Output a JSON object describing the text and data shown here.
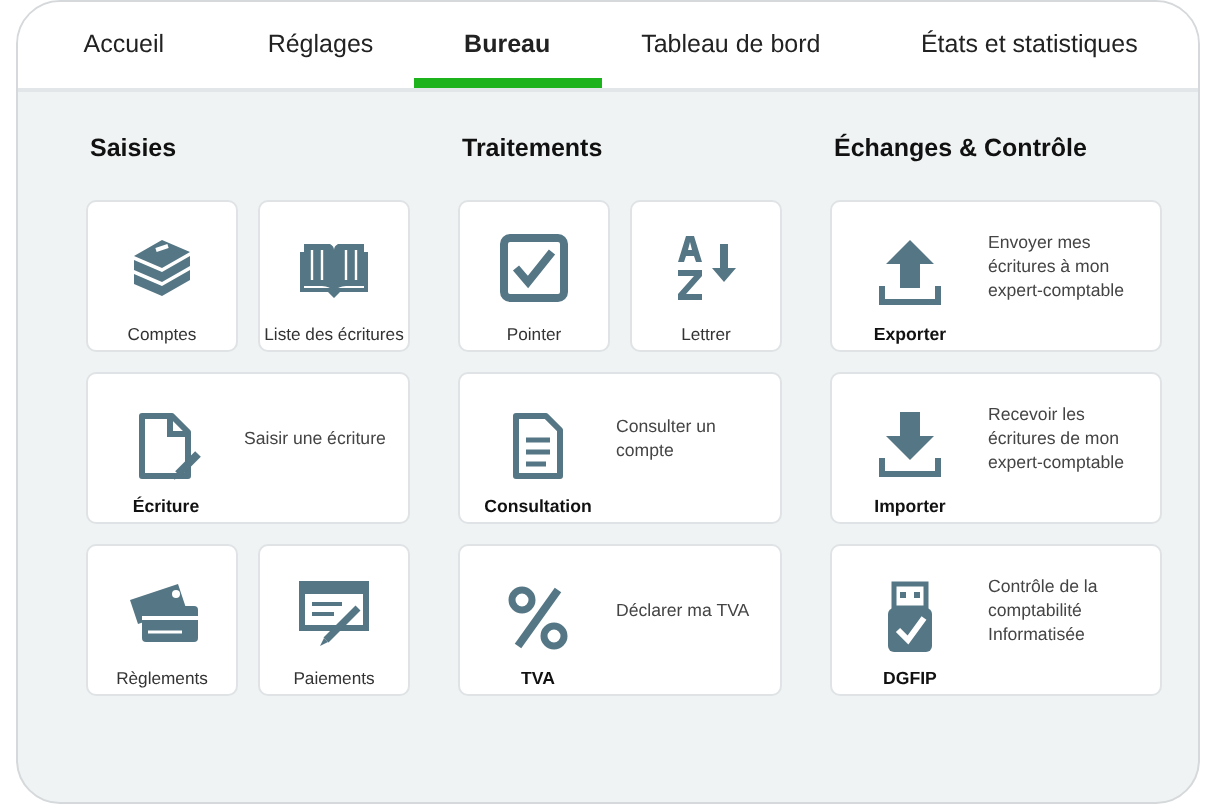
{
  "tabs": [
    {
      "label": "Accueil",
      "selected": false
    },
    {
      "label": "Réglages",
      "selected": false
    },
    {
      "label": "Bureau",
      "selected": true
    },
    {
      "label": "Tableau de bord",
      "selected": false
    },
    {
      "label": "États et statistiques",
      "selected": false
    }
  ],
  "sections": [
    {
      "title": "Saisies",
      "tiles": [
        {
          "kind": "small",
          "label": "Comptes"
        },
        {
          "kind": "small",
          "label": "Liste des écritures"
        },
        {
          "kind": "wide",
          "label": "Écriture",
          "description": "Saisir une écriture"
        },
        {
          "kind": "small",
          "label": "Règlements"
        },
        {
          "kind": "small",
          "label": "Paiements"
        }
      ]
    },
    {
      "title": "Traitements",
      "tiles": [
        {
          "kind": "small",
          "label": "Pointer"
        },
        {
          "kind": "small",
          "label": "Lettrer"
        },
        {
          "kind": "wide",
          "label": "Consultation",
          "description": "Consulter un compte"
        },
        {
          "kind": "wide",
          "label": "TVA",
          "description": "Déclarer ma TVA"
        }
      ]
    },
    {
      "title": "Échanges & Contrôle",
      "tiles": [
        {
          "kind": "wide",
          "label": "Exporter",
          "description": "Envoyer mes écritures à mon expert-comptable"
        },
        {
          "kind": "wide",
          "label": "Importer",
          "description": "Recevoir les écritures de mon expert-comptable"
        },
        {
          "kind": "wide",
          "label": "DGFIP",
          "description": "Contrôle de la comptabilité Informatisée"
        }
      ]
    }
  ]
}
